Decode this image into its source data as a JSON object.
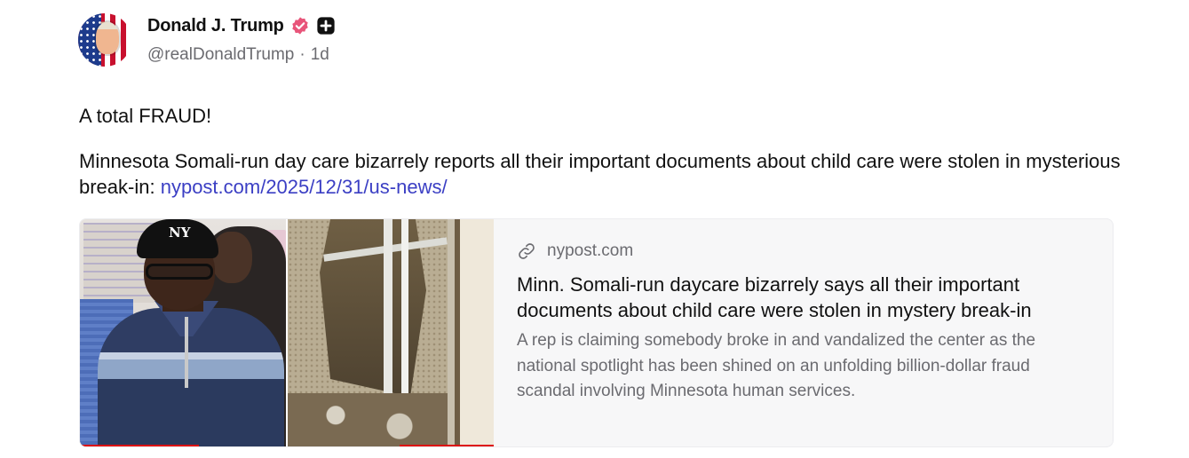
{
  "post": {
    "author": {
      "display_name": "Donald J. Trump",
      "handle": "@realDonaldTrump",
      "separator": "·",
      "time_ago": "1d",
      "verified_color": "#e8557a"
    },
    "text": {
      "line1": "A total FRAUD!",
      "body": "Minnesota Somali-run day care bizarrely reports all their important documents about child care were stolen in mysterious break-in:",
      "link": "nypost.com/2025/12/31/us-news/"
    },
    "link_card": {
      "domain": "nypost.com",
      "title": "Minn. Somali-run daycare bizarrely says all their important documents about child care were stolen in mystery break-in",
      "description": "A rep is claiming somebody broke in and vandalized the center as the national spotlight has been shined on an unfolding billion-dollar fraud scandal involving Minnesota human services."
    },
    "colors": {
      "link": "#3b3fc4",
      "muted": "#6b6b70"
    },
    "icons": {
      "verified": "verified-badge-icon",
      "plus": "plus-square-icon",
      "link": "link-chain-icon"
    }
  }
}
